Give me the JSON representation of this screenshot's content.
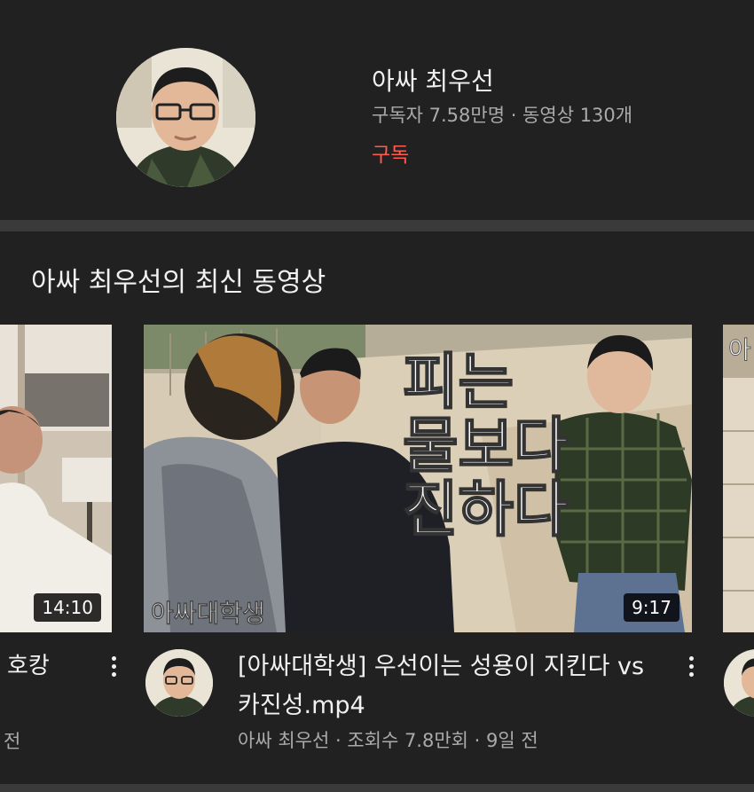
{
  "channel": {
    "name": "아싸 최우선",
    "stats": "구독자 7.58만명 · 동영상 130개",
    "subscribe_label": "구독"
  },
  "section": {
    "title": "아싸 최우선의 최신 동영상"
  },
  "videos": [
    {
      "title_fragment": "호캉",
      "duration": "14:10",
      "meta_fragment": "전"
    },
    {
      "title": "[아싸대학생] 우선이는 성용이 지킨다 vs 카진성.mp4",
      "duration": "9:17",
      "channel": "아싸 최우선",
      "views": "조회수 7.8만회",
      "age": "9일 전",
      "thumbnail_text": "피는 물보다 진하다",
      "thumbnail_watermark": "아싸대학생"
    },
    {
      "thumbnail_text_fragment": "아"
    }
  ],
  "meta_separator": " · ",
  "colors": {
    "background": "#212121",
    "subscribe": "#ff5b4e",
    "secondary_text": "#aaaaaa"
  }
}
